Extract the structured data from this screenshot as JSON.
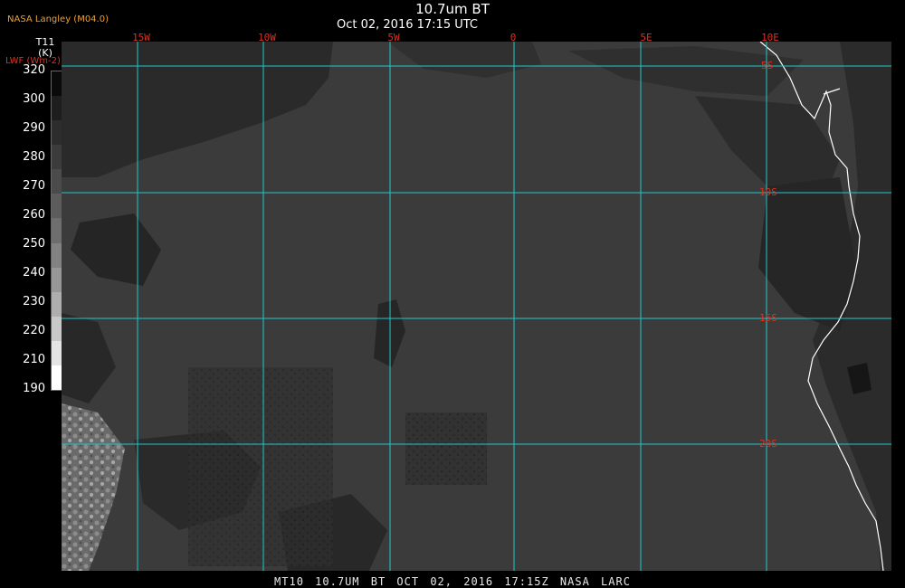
{
  "header": {
    "brand": "NASA Langley (M04.0)",
    "title": "10.7um BT",
    "subtitle": "Oct 02, 2016 17:15 UTC"
  },
  "colorbar": {
    "var_name": "T11",
    "var_unit": "(K)",
    "alt_unit": "LWF (Wm-2)",
    "ticks": [
      "320",
      "300",
      "290",
      "280",
      "270",
      "260",
      "250",
      "240",
      "230",
      "220",
      "210",
      "190"
    ],
    "colors": [
      "#0a0a0a",
      "#1e1e1e",
      "#2d2d2d",
      "#3c3c3c",
      "#4b4b4b",
      "#5c5c5c",
      "#6e6e6e",
      "#828282",
      "#979797",
      "#aeaeae",
      "#c8c8c8",
      "#e4e4e4",
      "#ffffff"
    ]
  },
  "map": {
    "lon_labels": [
      "15W",
      "10W",
      "5W",
      "0",
      "5E",
      "10E"
    ],
    "lat_labels": [
      "5S",
      "10S",
      "15S",
      "20S"
    ],
    "grid_color": "#20c8c8",
    "label_color": "#e03020",
    "coast_color": "#ffffff"
  },
  "footer": {
    "text": "MT10  10.7UM BT   OCT 02, 2016 17:15Z   NASA LARC"
  }
}
